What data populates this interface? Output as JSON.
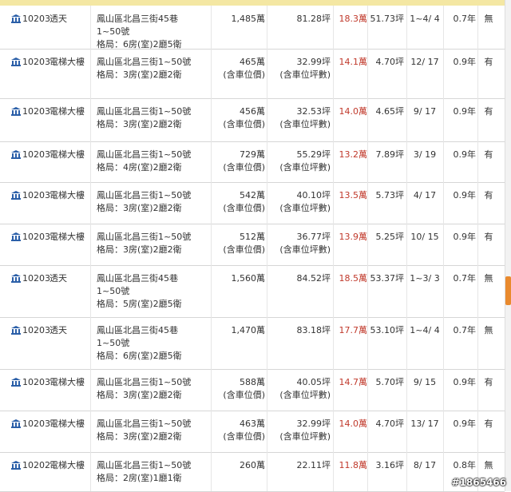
{
  "rows": [
    {
      "date": "10203",
      "type": "透天",
      "address": "鳳山區北昌三街45巷1~50號",
      "layout": "格局：6房(室)2廳5衛",
      "price": "1,485萬",
      "price_note": "",
      "area": "81.28坪",
      "area_note": "",
      "unit_price": "18.3萬",
      "land": "51.73坪",
      "floor": "1~4/ 4",
      "age": "0.7年",
      "parking": "無"
    },
    {
      "date": "10203",
      "type": "電梯大樓",
      "address": "鳳山區北昌三街1~50號",
      "layout": "格局：3房(室)2廳2衛",
      "price": "465萬",
      "price_note": "(含車位價)",
      "area": "32.99坪",
      "area_note": "(含車位坪數)",
      "unit_price": "14.1萬",
      "land": "4.70坪",
      "floor": "12/ 17",
      "age": "0.9年",
      "parking": "有"
    },
    {
      "date": "10203",
      "type": "電梯大樓",
      "address": "鳳山區北昌三街1~50號",
      "layout": "格局：3房(室)2廳2衛",
      "price": "456萬",
      "price_note": "(含車位價)",
      "area": "32.53坪",
      "area_note": "(含車位坪數)",
      "unit_price": "14.0萬",
      "land": "4.65坪",
      "floor": "9/ 17",
      "age": "0.9年",
      "parking": "有"
    },
    {
      "date": "10203",
      "type": "電梯大樓",
      "address": "鳳山區北昌三街1~50號",
      "layout": "格局：4房(室)2廳2衛",
      "price": "729萬",
      "price_note": "(含車位價)",
      "area": "55.29坪",
      "area_note": "(含車位坪數)",
      "unit_price": "13.2萬",
      "land": "7.89坪",
      "floor": "3/ 19",
      "age": "0.9年",
      "parking": "有"
    },
    {
      "date": "10203",
      "type": "電梯大樓",
      "address": "鳳山區北昌三街1~50號",
      "layout": "格局：3房(室)2廳2衛",
      "price": "542萬",
      "price_note": "(含車位價)",
      "area": "40.10坪",
      "area_note": "(含車位坪數)",
      "unit_price": "13.5萬",
      "land": "5.73坪",
      "floor": "4/ 17",
      "age": "0.9年",
      "parking": "有"
    },
    {
      "date": "10203",
      "type": "電梯大樓",
      "address": "鳳山區北昌三街1~50號",
      "layout": "格局：3房(室)2廳2衛",
      "price": "512萬",
      "price_note": "(含車位價)",
      "area": "36.77坪",
      "area_note": "(含車位坪數)",
      "unit_price": "13.9萬",
      "land": "5.25坪",
      "floor": "10/ 15",
      "age": "0.9年",
      "parking": "有"
    },
    {
      "date": "10203",
      "type": "透天",
      "address": "鳳山區北昌三街45巷1~50號",
      "layout": "格局：5房(室)2廳5衛",
      "price": "1,560萬",
      "price_note": "",
      "area": "84.52坪",
      "area_note": "",
      "unit_price": "18.5萬",
      "land": "53.37坪",
      "floor": "1~3/ 3",
      "age": "0.7年",
      "parking": "無"
    },
    {
      "date": "10203",
      "type": "透天",
      "address": "鳳山區北昌三街45巷1~50號",
      "layout": "格局：6房(室)2廳5衛",
      "price": "1,470萬",
      "price_note": "",
      "area": "83.18坪",
      "area_note": "",
      "unit_price": "17.7萬",
      "land": "53.10坪",
      "floor": "1~4/ 4",
      "age": "0.7年",
      "parking": "無"
    },
    {
      "date": "10203",
      "type": "電梯大樓",
      "address": "鳳山區北昌三街1~50號",
      "layout": "格局：3房(室)2廳2衛",
      "price": "588萬",
      "price_note": "(含車位價)",
      "area": "40.05坪",
      "area_note": "(含車位坪數)",
      "unit_price": "14.7萬",
      "land": "5.70坪",
      "floor": "9/ 15",
      "age": "0.9年",
      "parking": "有"
    },
    {
      "date": "10203",
      "type": "電梯大樓",
      "address": "鳳山區北昌三街1~50號",
      "layout": "格局：3房(室)2廳2衛",
      "price": "463萬",
      "price_note": "(含車位價)",
      "area": "32.99坪",
      "area_note": "(含車位坪數)",
      "unit_price": "14.0萬",
      "land": "4.70坪",
      "floor": "13/ 17",
      "age": "0.9年",
      "parking": "有"
    },
    {
      "date": "10202",
      "type": "電梯大樓",
      "address": "鳳山區北昌三街1~50號",
      "layout": "格局：2房(室)1廳1衛",
      "price": "260萬",
      "price_note": "",
      "area": "22.11坪",
      "area_note": "",
      "unit_price": "11.8萬",
      "land": "3.16坪",
      "floor": "8/ 17",
      "age": "0.8年",
      "parking": "無"
    }
  ],
  "watermark": "#1865466",
  "colors": {
    "unit_price": "#c0392b",
    "header_bar": "#f4e7a3",
    "scroll_handle": "#e98a2e"
  }
}
